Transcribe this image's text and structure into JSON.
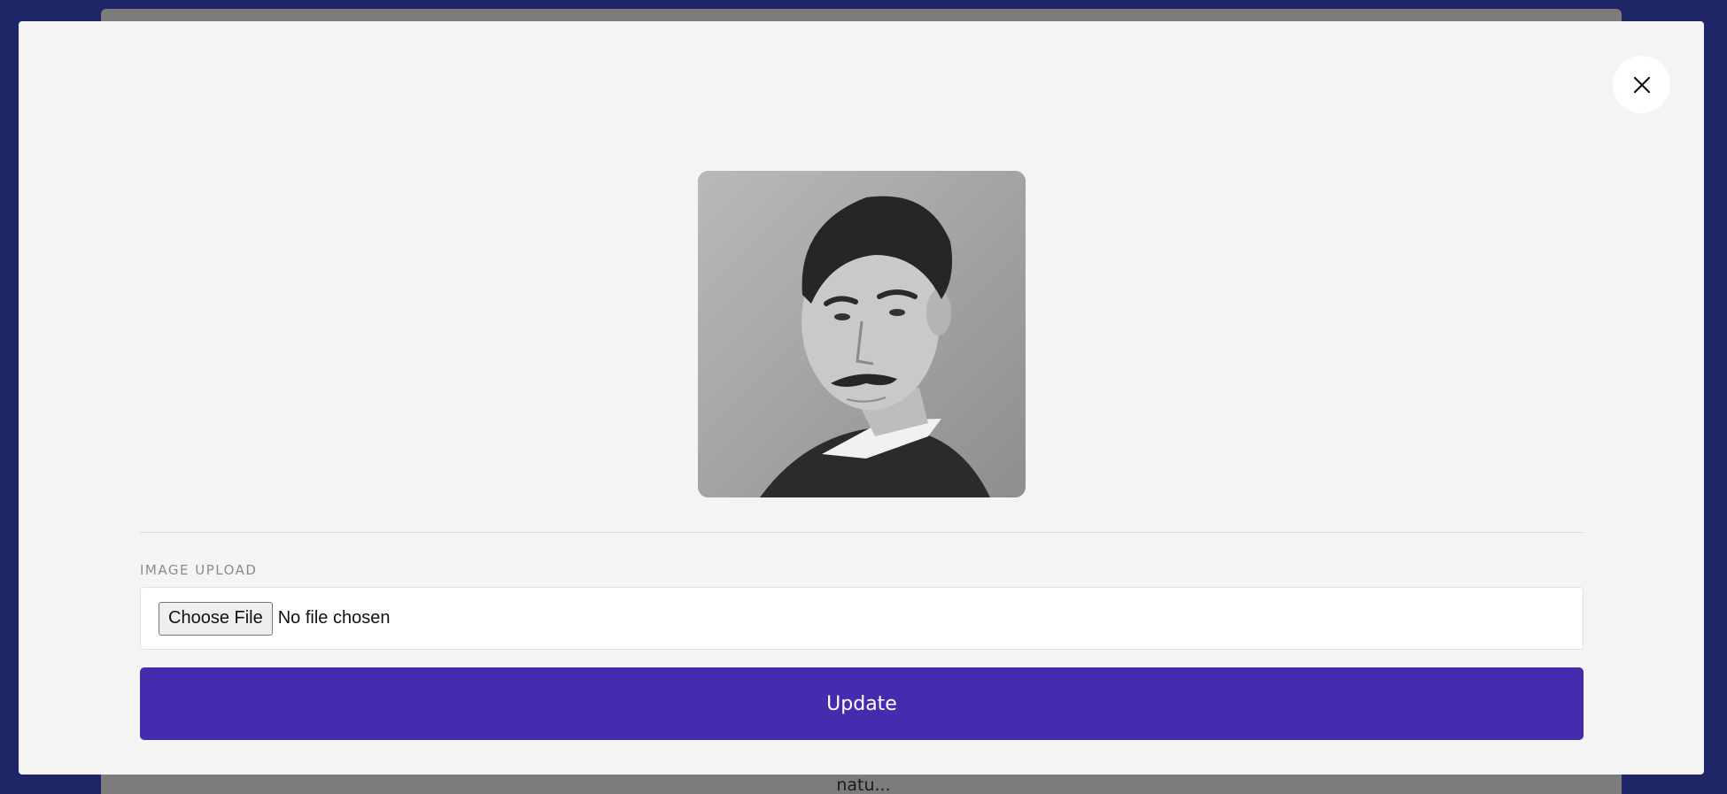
{
  "background": {
    "snippet_text": "natu..."
  },
  "modal": {
    "close_icon": "close-icon",
    "preview_image": "portrait-photo",
    "upload": {
      "label": "IMAGE UPLOAD",
      "choose_label": "Choose File",
      "status": "No file chosen"
    },
    "submit_label": "Update"
  },
  "colors": {
    "page_background": "#1e2567",
    "modal_background": "#f4f4f4",
    "accent": "#452caf"
  }
}
